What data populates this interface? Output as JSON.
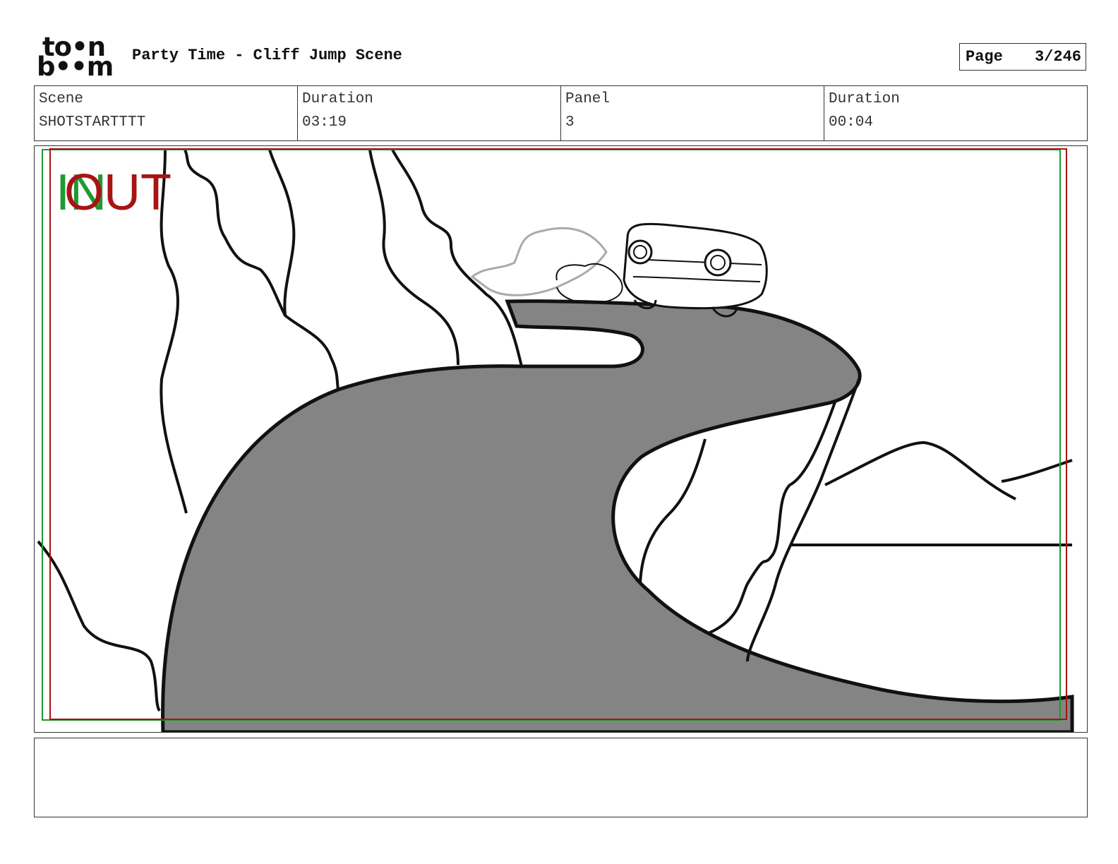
{
  "header": {
    "logo_line1": "to•n",
    "logo_line2": "b••m",
    "title": "Party Time - Cliff Jump Scene",
    "page_label": "Page",
    "page_value": "3/246"
  },
  "info": [
    {
      "label": "Scene",
      "value": "SHOTSTARTTTT"
    },
    {
      "label": "Duration",
      "value": "03:19"
    },
    {
      "label": "Panel",
      "value": "3"
    },
    {
      "label": "Duration",
      "value": "00:04"
    }
  ],
  "panel": {
    "in_marker": "IN",
    "out_marker": "OUT",
    "colors": {
      "in": "#1e9a32",
      "out": "#a71414",
      "road": "#848484",
      "ink": "#111111",
      "sketch": "#aaaaaa"
    }
  },
  "notes": {
    "text": ""
  }
}
